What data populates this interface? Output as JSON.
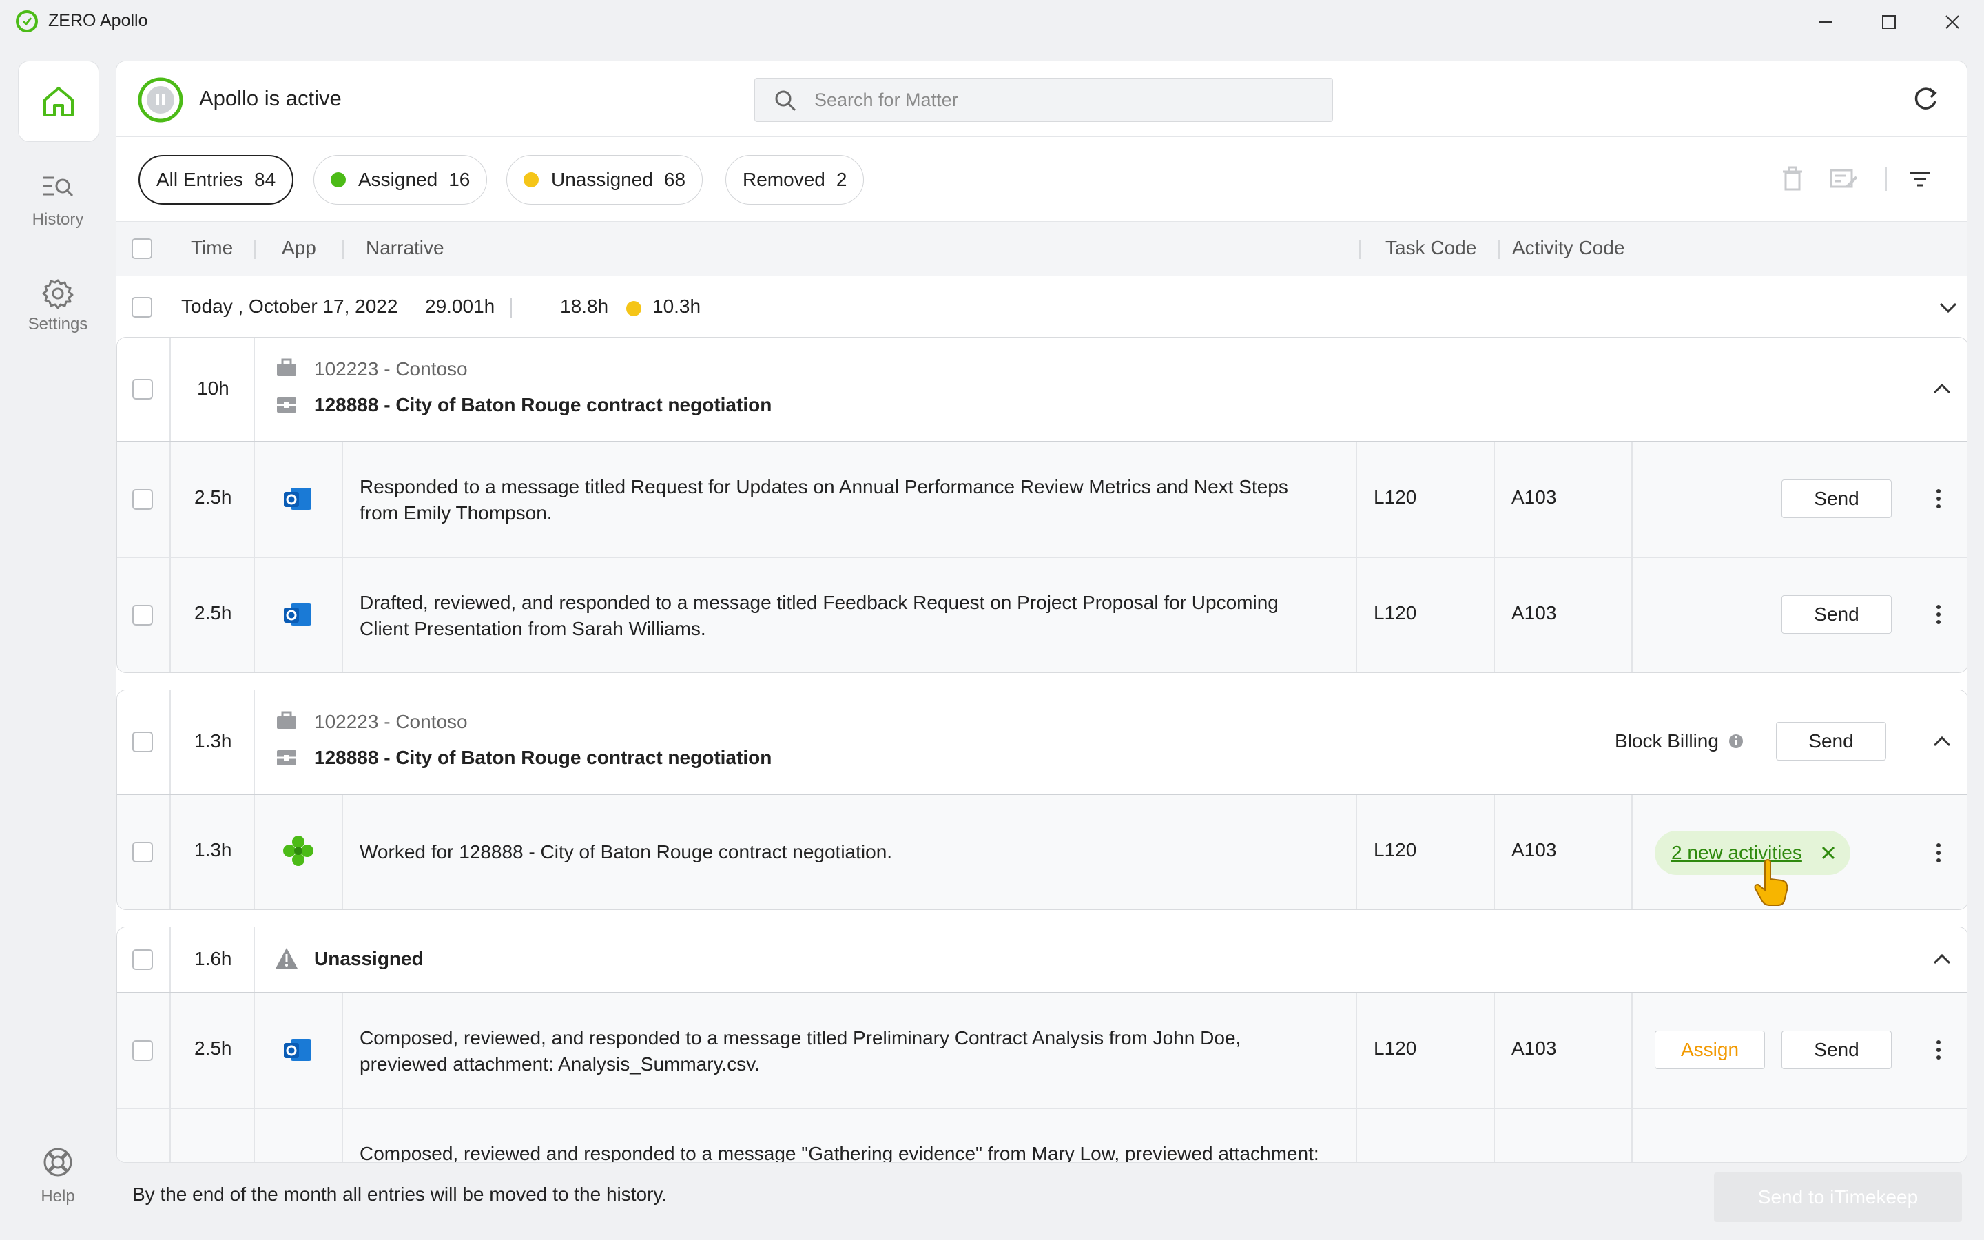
{
  "app": {
    "title": "ZERO Apollo"
  },
  "sidebar": {
    "items": [
      {
        "label": "History"
      },
      {
        "label": "Settings"
      },
      {
        "label": "Help"
      }
    ]
  },
  "header": {
    "status": "Apollo is active",
    "search_placeholder": "Search for Matter"
  },
  "filters": [
    {
      "label": "All Entries",
      "count": "84"
    },
    {
      "label": "Assigned",
      "count": "16",
      "color": "#4cbb17"
    },
    {
      "label": "Unassigned",
      "count": "68",
      "color": "#f5c518"
    },
    {
      "label": "Removed",
      "count": "2"
    }
  ],
  "columns": {
    "time": "Time",
    "app": "App",
    "narrative": "Narrative",
    "task": "Task Code",
    "activity": "Activity Code"
  },
  "day": {
    "label": "Today , October 17, 2022",
    "total": "29.001h",
    "assigned": "18.8h",
    "unassigned": "10.3h"
  },
  "groups": [
    {
      "time": "10h",
      "client": "102223 - Contoso",
      "matter": "128888 - City of Baton Rouge contract negotiation",
      "entries": [
        {
          "time": "2.5h",
          "app": "outlook-icon",
          "narrative": "Responded to a message titled Request for Updates on Annual Performance Review Metrics and Next Steps from Emily Thompson.",
          "task": "L120",
          "activity": "A103",
          "send": "Send"
        },
        {
          "time": "2.5h",
          "app": "outlook-icon",
          "narrative": "Drafted, reviewed, and responded to a message titled Feedback Request on Project Proposal for Upcoming Client Presentation from Sarah Williams.",
          "task": "L120",
          "activity": "A103",
          "send": "Send"
        }
      ]
    },
    {
      "time": "1.3h",
      "client": "102223 - Contoso",
      "matter": "128888 - City of Baton Rouge contract negotiation",
      "block_billing": "Block Billing",
      "send": "Send",
      "entries": [
        {
          "time": "1.3h",
          "app": "apollo-flower-icon",
          "narrative": "Worked for 128888 - City of Baton Rouge contract negotiation.",
          "task": "L120",
          "activity": "A103",
          "badge": "2 new activities"
        }
      ]
    },
    {
      "time": "1.6h",
      "label": "Unassigned",
      "entries": [
        {
          "time": "2.5h",
          "app": "outlook-icon",
          "narrative": "Composed, reviewed, and responded to a message titled Preliminary Contract Analysis from John Doe, previewed attachment: Analysis_Summary.csv.",
          "task": "L120",
          "activity": "A103",
          "assign": "Assign",
          "send": "Send"
        },
        {
          "narrative": "Composed, reviewed and responded to a message \"Gathering evidence\" from Mary Low, previewed attachment:"
        }
      ]
    }
  ],
  "footer": {
    "notice": "By the end of the month all entries will be moved to the history.",
    "send_all": "Send to iTimekeep"
  }
}
